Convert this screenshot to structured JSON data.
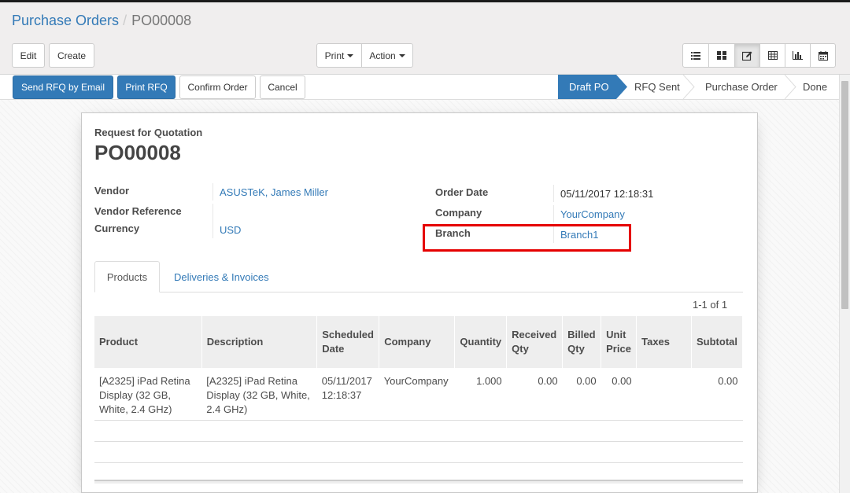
{
  "breadcrumb": {
    "parent": "Purchase Orders",
    "separator": "/",
    "current": "PO00008"
  },
  "toolbar": {
    "edit": "Edit",
    "create": "Create",
    "print": "Print",
    "action": "Action"
  },
  "views": [
    "list-view-icon",
    "kanban-view-icon",
    "form-view-icon",
    "pivot-view-icon",
    "graph-view-icon",
    "calendar-view-icon"
  ],
  "statusbar": {
    "buttons": {
      "send_rfq": "Send RFQ by Email",
      "print_rfq": "Print RFQ",
      "confirm": "Confirm Order",
      "cancel": "Cancel"
    },
    "stages": [
      "Draft PO",
      "RFQ Sent",
      "Purchase Order",
      "Done"
    ],
    "active_stage": "Draft PO"
  },
  "form": {
    "subtitle": "Request for Quotation",
    "title": "PO00008",
    "vendor_label": "Vendor",
    "vendor": "ASUSTeK, James Miller",
    "vendor_ref_label": "Vendor Reference",
    "currency_label": "Currency",
    "currency": "USD",
    "order_date_label": "Order Date",
    "order_date": "05/11/2017 12:18:31",
    "company_label": "Company",
    "company": "YourCompany",
    "branch_label": "Branch",
    "branch": "Branch1"
  },
  "tabs": {
    "products": "Products",
    "deliveries": "Deliveries & Invoices"
  },
  "pager": "1-1 of 1",
  "table": {
    "headers": {
      "product": "Product",
      "description": "Description",
      "scheduled_date": "Scheduled Date",
      "company": "Company",
      "quantity": "Quantity",
      "received_qty": "Received Qty",
      "billed_qty": "Billed Qty",
      "unit_price": "Unit Price",
      "taxes": "Taxes",
      "subtotal": "Subtotal"
    },
    "rows": [
      {
        "product": "[A2325] iPad Retina Display (32 GB, White, 2.4 GHz)",
        "description": "[A2325] iPad Retina Display (32 GB, White, 2.4 GHz)",
        "scheduled_date": "05/11/2017 12:18:37",
        "company": "YourCompany",
        "quantity": "1.000",
        "received_qty": "0.00",
        "billed_qty": "0.00",
        "unit_price": "0.00",
        "taxes": "",
        "subtotal": "0.00"
      }
    ]
  },
  "colors": {
    "primary": "#337ab7",
    "highlight": "#e50000",
    "panel_bg": "#f0eeee"
  }
}
